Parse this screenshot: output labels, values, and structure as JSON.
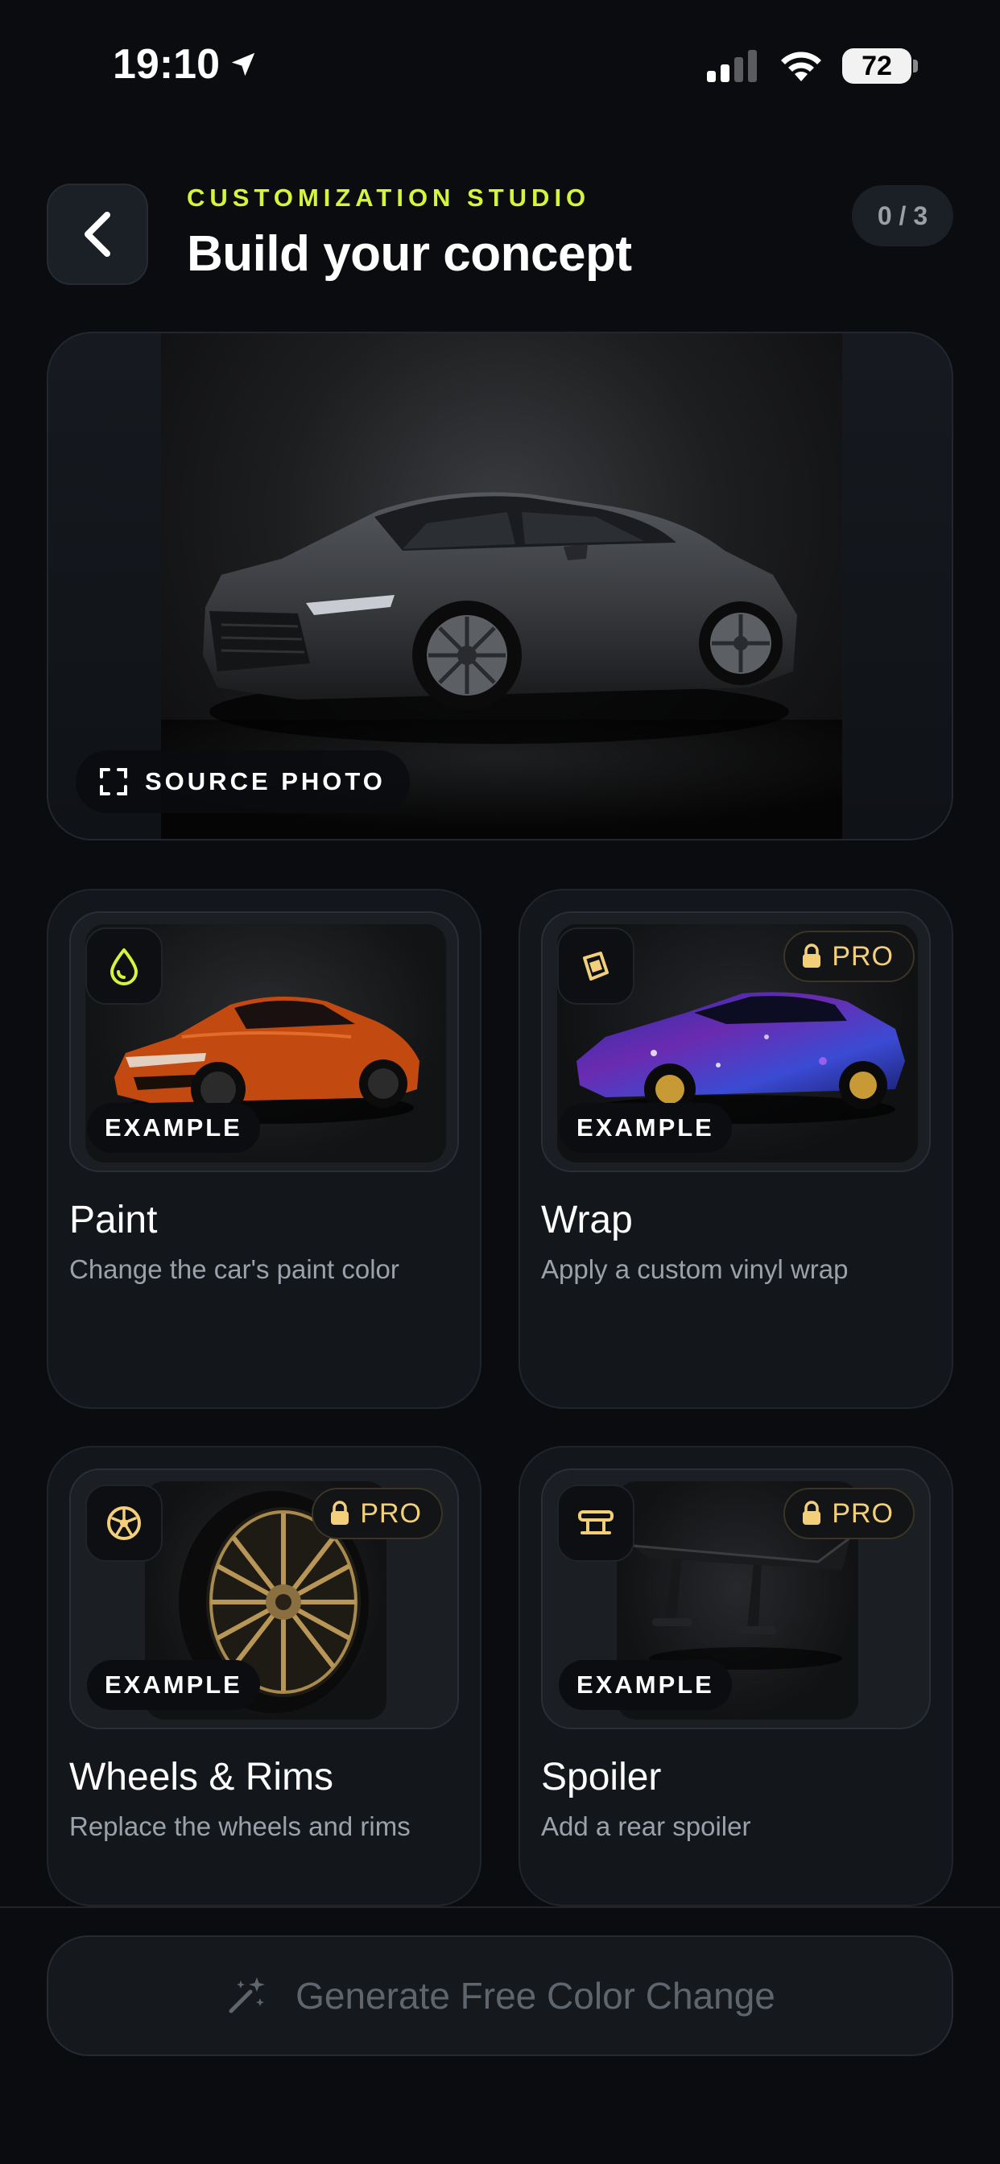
{
  "status_bar": {
    "time": "19:10",
    "battery": "72"
  },
  "header": {
    "eyebrow": "CUSTOMIZATION STUDIO",
    "title": "Build your concept",
    "counter": "0 / 3"
  },
  "hero": {
    "source_label": "SOURCE PHOTO"
  },
  "cards": [
    {
      "title": "Paint",
      "description": "Change the car's paint color",
      "badge": "EXAMPLE",
      "icon": "paint-drop-icon",
      "pro": false
    },
    {
      "title": "Wrap",
      "description": "Apply a custom vinyl wrap",
      "badge": "EXAMPLE",
      "icon": "wrap-icon",
      "pro": true,
      "pro_label": "PRO"
    },
    {
      "title": "Wheels & Rims",
      "description": "Replace the wheels and rims",
      "badge": "EXAMPLE",
      "icon": "wheel-icon",
      "pro": true,
      "pro_label": "PRO"
    },
    {
      "title": "Spoiler",
      "description": "Add a rear spoiler",
      "badge": "EXAMPLE",
      "icon": "spoiler-icon",
      "pro": true,
      "pro_label": "PRO"
    }
  ],
  "generate_button": {
    "label": "Generate Free Color Change",
    "icon": "magic-wand-icon"
  },
  "colors": {
    "accent": "#d4f53c",
    "pro": "#f3cf7a",
    "background": "#0a0c0f"
  }
}
